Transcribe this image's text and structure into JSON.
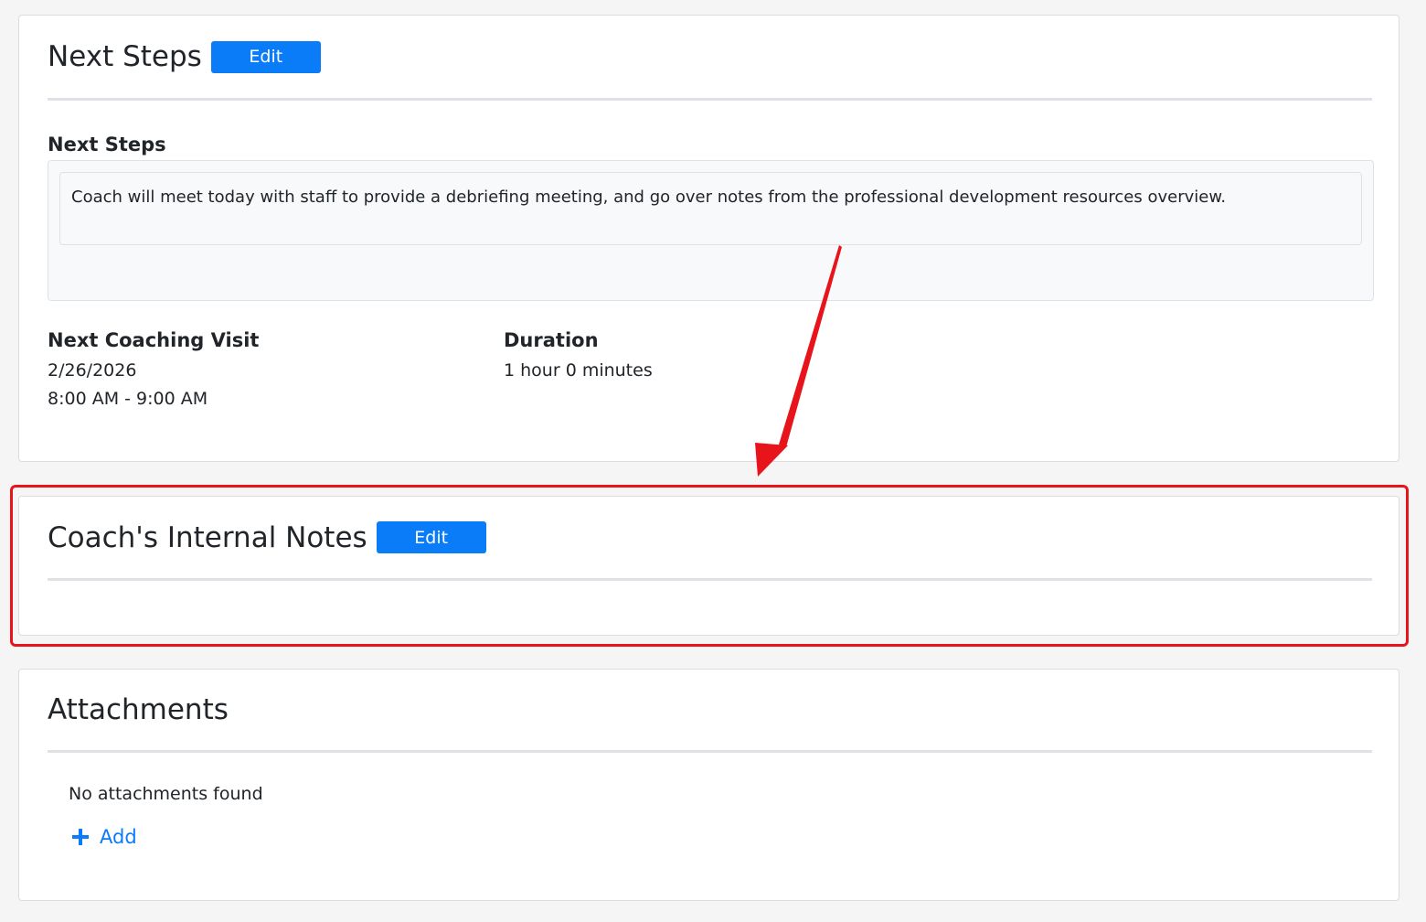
{
  "next_steps_card": {
    "title": "Next Steps",
    "edit_label": "Edit",
    "notes_label": "Next Steps",
    "notes_text": "Coach will meet today with staff to provide a debriefing meeting, and go over notes from the professional development resources overview.",
    "visit_label": "Next Coaching Visit",
    "visit_date": "2/26/2026",
    "visit_time": "8:00 AM - 9:00 AM",
    "duration_label": "Duration",
    "duration_value": "1 hour 0 minutes"
  },
  "internal_notes_card": {
    "title": "Coach's Internal Notes",
    "edit_label": "Edit"
  },
  "attachments_card": {
    "title": "Attachments",
    "empty_text": "No attachments found",
    "add_label": "Add"
  },
  "colors": {
    "primary": "#0a7cf8",
    "annotation_red": "#e8141c"
  },
  "icons": {
    "add": "plus-icon",
    "annotation": "arrow-annotation"
  }
}
